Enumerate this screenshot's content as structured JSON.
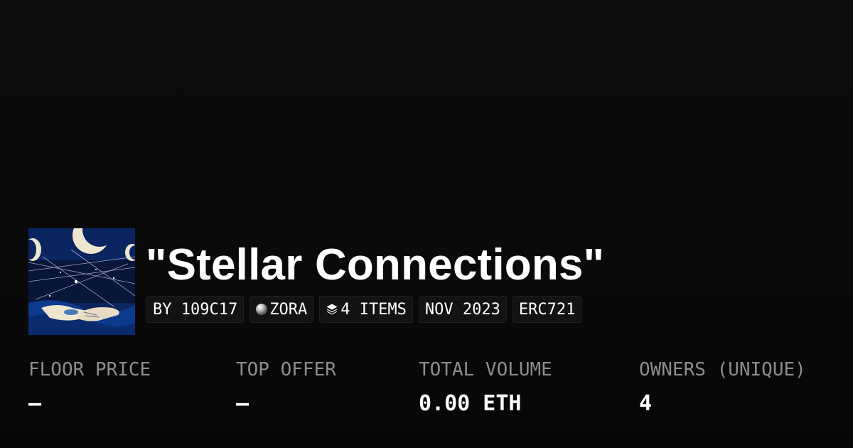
{
  "collection": {
    "title": "\"Stellar Connections\"",
    "image_description": "artwork-thumbnail"
  },
  "chips": [
    {
      "label": "BY 109C17",
      "icon": null
    },
    {
      "label": "ZORA",
      "icon": "zora-orb-icon"
    },
    {
      "label": "4 ITEMS",
      "icon": "layers-icon"
    },
    {
      "label": "NOV 2023",
      "icon": null
    },
    {
      "label": "ERC721",
      "icon": null
    }
  ],
  "stats": [
    {
      "label": "FLOOR PRICE",
      "value": "–"
    },
    {
      "label": "TOP OFFER",
      "value": "–"
    },
    {
      "label": "TOTAL VOLUME",
      "value": "0.00 ETH"
    },
    {
      "label": "OWNERS (UNIQUE)",
      "value": "4"
    }
  ],
  "colors": {
    "background": "#0a0a0a",
    "chip_background": "#131313",
    "label_gray": "#8d8d8d",
    "text": "#ffffff",
    "artwork_blue": "#0b2a64"
  }
}
